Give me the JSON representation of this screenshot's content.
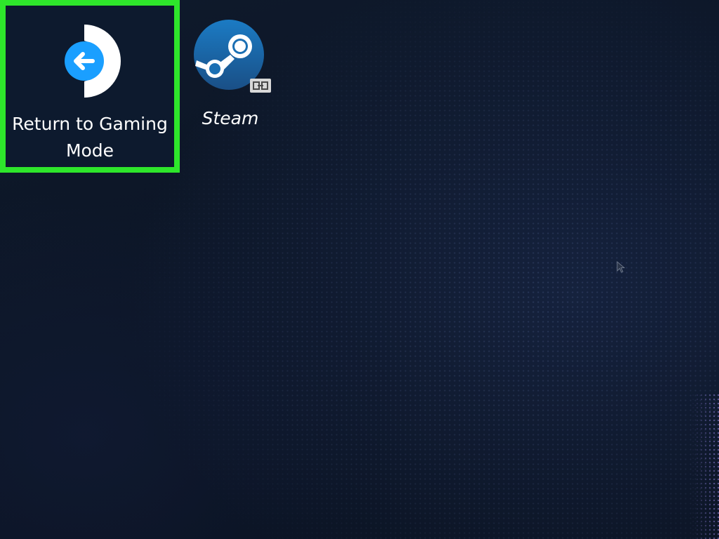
{
  "desktop": {
    "icons": [
      {
        "label": "Return to Gaming Mode",
        "icon": "return-arrow-icon",
        "highlighted": true
      },
      {
        "label": "Steam",
        "icon": "steam-logo-icon",
        "is_shortcut": true
      }
    ],
    "pointer": "mouse-cursor-icon"
  },
  "colors": {
    "highlight_border": "#2ee62b",
    "accent_blue": "#1a9fff",
    "background": "#0d1626"
  }
}
